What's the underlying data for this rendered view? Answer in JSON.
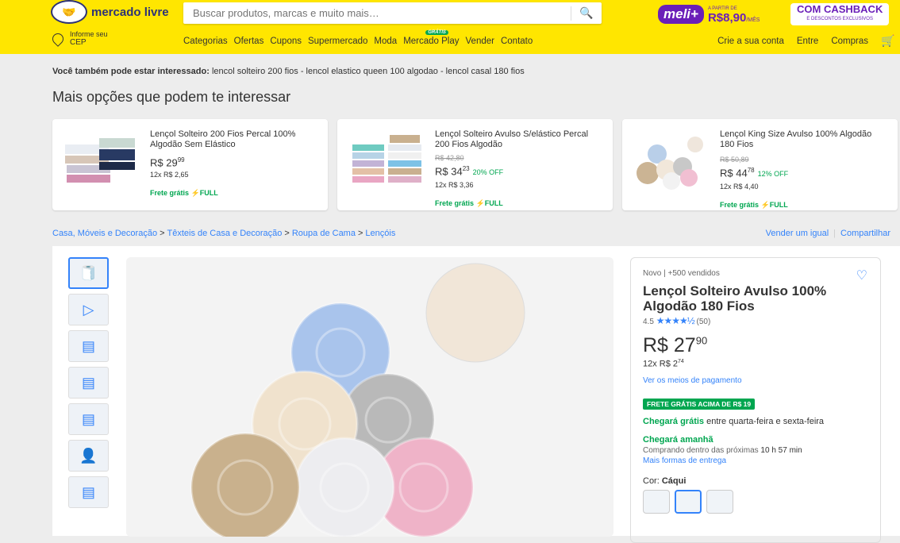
{
  "header": {
    "logo_text": "mercado livre",
    "search_placeholder": "Buscar produtos, marcas e muito mais…",
    "promo": {
      "meli": "meli+",
      "from": "A PARTIR DE",
      "price": "R$8,90",
      "per": "/MÊS",
      "cashback": "COM CASHBACK",
      "cashback_sub": "E DESCONTOS EXCLUSIVOS"
    },
    "cep_line1": "Informe seu",
    "cep_line2": "CEP",
    "nav": [
      "Categorias",
      "Ofertas",
      "Cupons",
      "Supermercado",
      "Moda",
      "Mercado Play",
      "Vender",
      "Contato"
    ],
    "nav_badge": "GRÁTIS",
    "account": [
      "Crie a sua conta",
      "Entre",
      "Compras"
    ]
  },
  "related": {
    "label": "Você também pode estar interessado:",
    "text": "lencol solteiro 200 fios - lencol elastico queen 100 algodao - lencol casal 180 fios"
  },
  "section_title": "Mais opções que podem te interessar",
  "cards": [
    {
      "title": "Lençol Solteiro 200 Fios Percal 100% Algodão Sem Elástico",
      "old": "",
      "price": "R$ 29",
      "cents": "99",
      "off": "",
      "inst": "12x R$ 2,65",
      "frete": "Frete grátis ⚡FULL"
    },
    {
      "title": "Lençol Solteiro Avulso S/elástico Percal 200 Fios Algodão",
      "old": "R$ 42,80",
      "price": "R$ 34",
      "cents": "23",
      "off": "20% OFF",
      "inst": "12x R$ 3,36",
      "frete": "Frete grátis ⚡FULL"
    },
    {
      "title": "Lençol King Size Avulso 100% Algodão 180 Fios",
      "old": "R$ 50,89",
      "price": "R$ 44",
      "cents": "78",
      "off": "12% OFF",
      "inst": "12x R$ 4,40",
      "frete": "Frete grátis ⚡FULL"
    }
  ],
  "breadcrumb": [
    "Casa, Móveis e Decoração",
    "Têxteis de Casa e Decoração",
    "Roupa de Cama",
    "Lençóis"
  ],
  "right_links": [
    "Vender um igual",
    "Compartilhar"
  ],
  "product": {
    "condition": "Novo | +500 vendidos",
    "title": "Lençol Solteiro Avulso 100% Algodão 180 Fios",
    "rating": "4.5",
    "stars": "★★★★½",
    "reviews": "(50)",
    "price": "R$ 27",
    "cents": "90",
    "installments": "12x R$ 2",
    "installments_cents": "74",
    "payment_link": "Ver os meios de pagamento",
    "badge": "FRETE GRÁTIS ACIMA DE R$ 19",
    "delivery1_green": "Chegará grátis",
    "delivery1_rest": " entre quarta-feira e sexta-feira",
    "delivery2": "Chegará amanhã",
    "delivery3_pre": "Comprando dentro das próximas ",
    "delivery3_bold": "10 h 57 min",
    "delivery_link": "Mais formas de entrega",
    "color_label": "Cor: ",
    "color_value": "Cáqui"
  },
  "colors": {
    "accent": "#3483fa",
    "brand_yellow": "#ffe600",
    "green": "#00a650"
  }
}
